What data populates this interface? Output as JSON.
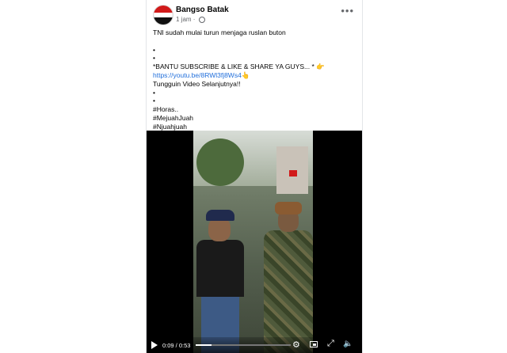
{
  "post": {
    "page_name": "Bangso Batak",
    "time": "1 jam",
    "visibility_icon": "globe-icon",
    "more_icon": "more-options-icon",
    "caption_lines": [
      {
        "text": "TNI sudah mulai turun menjaga ruslan buton",
        "kind": "text"
      },
      {
        "text": "",
        "kind": "text"
      },
      {
        "text": "•",
        "kind": "text"
      },
      {
        "text": "•",
        "kind": "text"
      },
      {
        "text": "*BANTU SUBSCRIBE & LIKE & SHARE YA GUYS... * 👉",
        "kind": "text"
      },
      {
        "text": "https://youtu.be/8RWl3fj8Ws4👆",
        "kind": "link"
      },
      {
        "text": " Tungguin Video Selanjutnya!!",
        "kind": "text"
      },
      {
        "text": "•",
        "kind": "text"
      },
      {
        "text": "•",
        "kind": "text"
      },
      {
        "text": "#Horas..",
        "kind": "tag"
      },
      {
        "text": "#MejuahJuah",
        "kind": "tag"
      },
      {
        "text": "#Njuahjuah",
        "kind": "tag"
      }
    ]
  },
  "video": {
    "time_display": "0:09 / 0:53",
    "progress": 0.17,
    "icons": [
      "play-icon",
      "settings-icon",
      "pip-icon",
      "fullscreen-icon",
      "volume-icon"
    ]
  },
  "colors": {
    "link": "#216fdb",
    "text": "#050505",
    "meta": "#65676b"
  }
}
